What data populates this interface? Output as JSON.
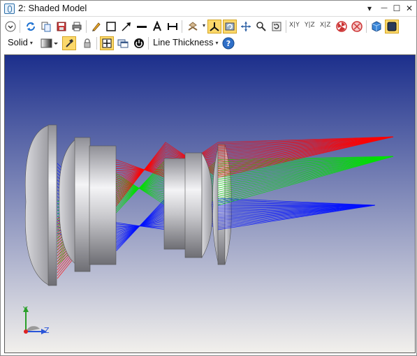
{
  "window": {
    "title": "2: Shaded Model",
    "controls": {
      "dropdown": "▾",
      "minimize": "—",
      "maximize": "☐",
      "close": "✕"
    }
  },
  "toolbar2": {
    "render_mode": "Solid",
    "line_thickness": "Line Thickness"
  },
  "toolbar1": {
    "axis_views": [
      "X|Y",
      "Y|Z",
      "X|Z"
    ]
  },
  "triad": {
    "y_label": "Y",
    "z_label": "Z"
  },
  "colors": {
    "viewport_top": "#1c2f8c",
    "viewport_bottom": "#f2f0ec",
    "ray_red": "#ff0000",
    "ray_green": "#00e000",
    "ray_blue": "#0010ff",
    "lens": "#c4c4c8"
  }
}
